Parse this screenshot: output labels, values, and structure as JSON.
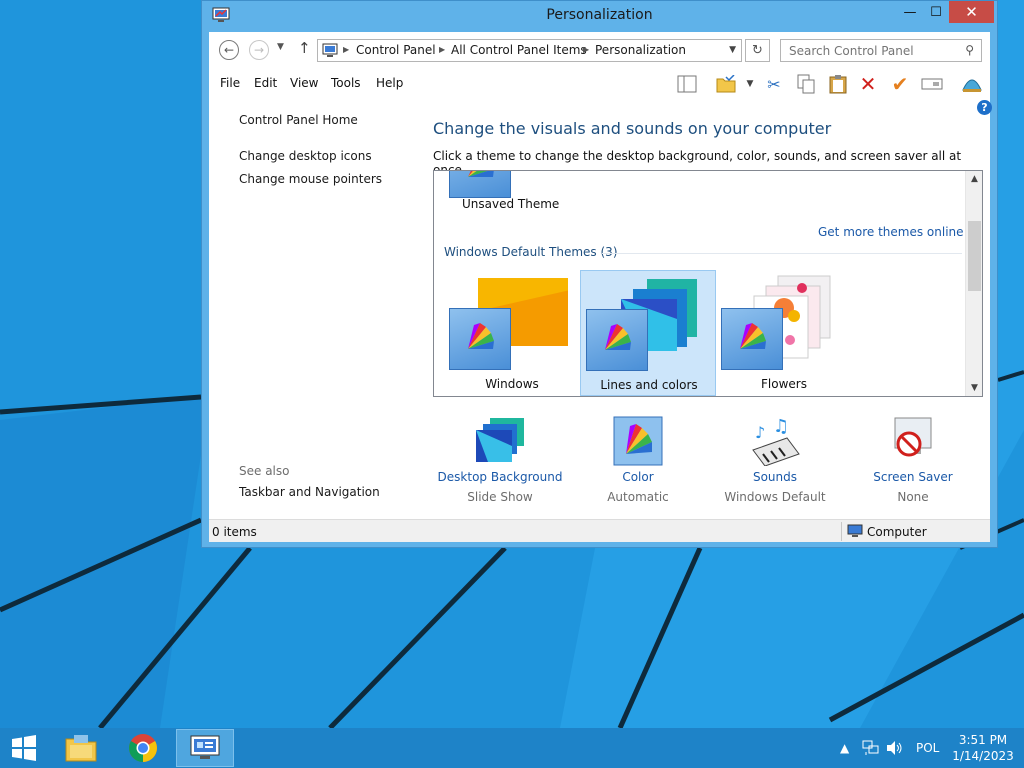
{
  "window": {
    "title": "Personalization",
    "controls": {
      "minimize": "—",
      "maximize": "☐",
      "close": "✕"
    }
  },
  "navigation": {
    "breadcrumb": [
      "Control Panel",
      "All Control Panel Items",
      "Personalization"
    ],
    "search_placeholder": "Search Control Panel"
  },
  "menu": [
    "File",
    "Edit",
    "View",
    "Tools",
    "Help"
  ],
  "left_pane": {
    "home": "Control Panel Home",
    "links": [
      "Change desktop icons",
      "Change mouse pointers"
    ],
    "see_also_label": "See also",
    "see_also_links": [
      "Taskbar and Navigation"
    ]
  },
  "main": {
    "title": "Change the visuals and sounds on your computer",
    "subtitle": "Click a theme to change the desktop background, color, sounds, and screen saver all at once."
  },
  "themes": {
    "unsaved": "Unsaved Theme",
    "get_more": "Get more themes online",
    "group_heading": "Windows Default Themes (3)",
    "items": [
      {
        "name": "Windows",
        "selected": false
      },
      {
        "name": "Lines and colors",
        "selected": true
      },
      {
        "name": "Flowers",
        "selected": false
      }
    ]
  },
  "settings": [
    {
      "title": "Desktop Background",
      "value": "Slide Show",
      "icon": "desktop-background-icon"
    },
    {
      "title": "Color",
      "value": "Automatic",
      "icon": "color-icon"
    },
    {
      "title": "Sounds",
      "value": "Windows Default",
      "icon": "sounds-icon"
    },
    {
      "title": "Screen Saver",
      "value": "None",
      "icon": "screen-saver-icon"
    }
  ],
  "statusbar": {
    "items": "0 items",
    "location": "Computer"
  },
  "taskbar": {
    "tray_language": "POL",
    "time": "3:51 PM",
    "date": "1/14/2023",
    "tray_arrow": "▲"
  },
  "colors": {
    "accent": "#1e83c8",
    "title_link": "#1e4f7f",
    "link": "#1b59a8",
    "close": "#c74c46"
  }
}
